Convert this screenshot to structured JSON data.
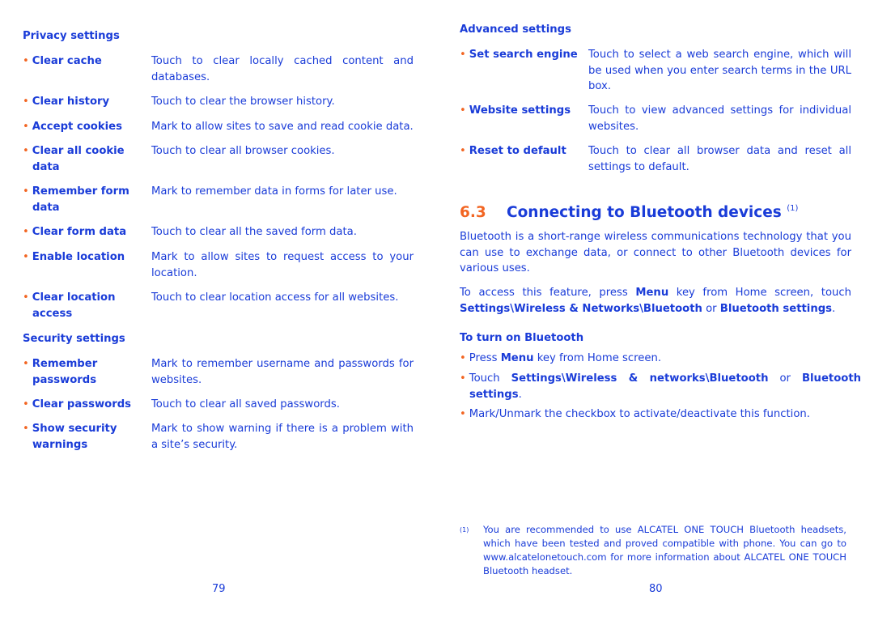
{
  "left": {
    "privacy_heading": "Privacy settings",
    "privacy_items": [
      {
        "label": "Clear cache",
        "desc": "Touch to clear locally cached content and databases."
      },
      {
        "label": "Clear history",
        "desc": "Touch to clear the browser history."
      },
      {
        "label": "Accept cookies",
        "desc": "Mark to allow sites to save and read cookie data."
      },
      {
        "label": "Clear all cookie data",
        "desc": "Touch to clear all browser cookies."
      },
      {
        "label": "Remember form data",
        "desc": "Mark to remember data in forms for later use."
      },
      {
        "label": "Clear form data",
        "desc": "Touch to clear all the saved form data."
      },
      {
        "label": "Enable location",
        "desc": "Mark to allow sites to request access to your location."
      },
      {
        "label": "Clear location access",
        "desc": "Touch to clear location access for all websites."
      }
    ],
    "security_heading": "Security settings",
    "security_items": [
      {
        "label": "Remember passwords",
        "desc": "Mark to remember username and passwords for websites."
      },
      {
        "label": "Clear passwords",
        "desc": "Touch to clear all saved passwords."
      },
      {
        "label": "Show security warnings",
        "desc": "Mark to show warning if there is a problem with a site’s security."
      }
    ],
    "page_number": "79"
  },
  "right": {
    "advanced_heading": "Advanced settings",
    "advanced_items": [
      {
        "label": "Set search engine",
        "desc": "Touch to select a web search engine, which will be used when you enter search terms in the URL box."
      },
      {
        "label": "Website settings",
        "desc": "Touch to view advanced settings for individual websites."
      },
      {
        "label": "Reset to default",
        "desc": "Touch to clear all browser data and reset all settings to default."
      }
    ],
    "section_number": "6.3",
    "section_title": "Connecting to Bluetooth devices",
    "section_footnote_mark": "(1)",
    "intro": "Bluetooth is a short-range wireless communications technology that you can use to exchange data, or connect to other Bluetooth devices for various uses.",
    "access": [
      "To access this feature, press ",
      "Menu",
      " key from Home screen, touch ",
      "Settings\\Wireless & Networks\\Bluetooth",
      " or ",
      "Bluetooth settings",
      "."
    ],
    "turn_on_heading": "To turn on Bluetooth",
    "step1": [
      "Press ",
      "Menu",
      " key from Home screen."
    ],
    "step2": [
      "Touch ",
      "Settings\\Wireless & networks\\Bluetooth",
      " or ",
      "Bluetooth settings",
      "."
    ],
    "step3": "Mark/Unmark the checkbox to activate/deactivate this function.",
    "footnote_mark": "(1)",
    "footnote": "You are recommended to use ALCATEL ONE TOUCH Bluetooth headsets, which have been tested and proved compatible with phone. You can go to www.alcatelonetouch.com for more information about ALCATEL ONE TOUCH Bluetooth headset.",
    "page_number": "80"
  },
  "colors": {
    "text": "#1a3cd8",
    "accent": "#f26522"
  }
}
